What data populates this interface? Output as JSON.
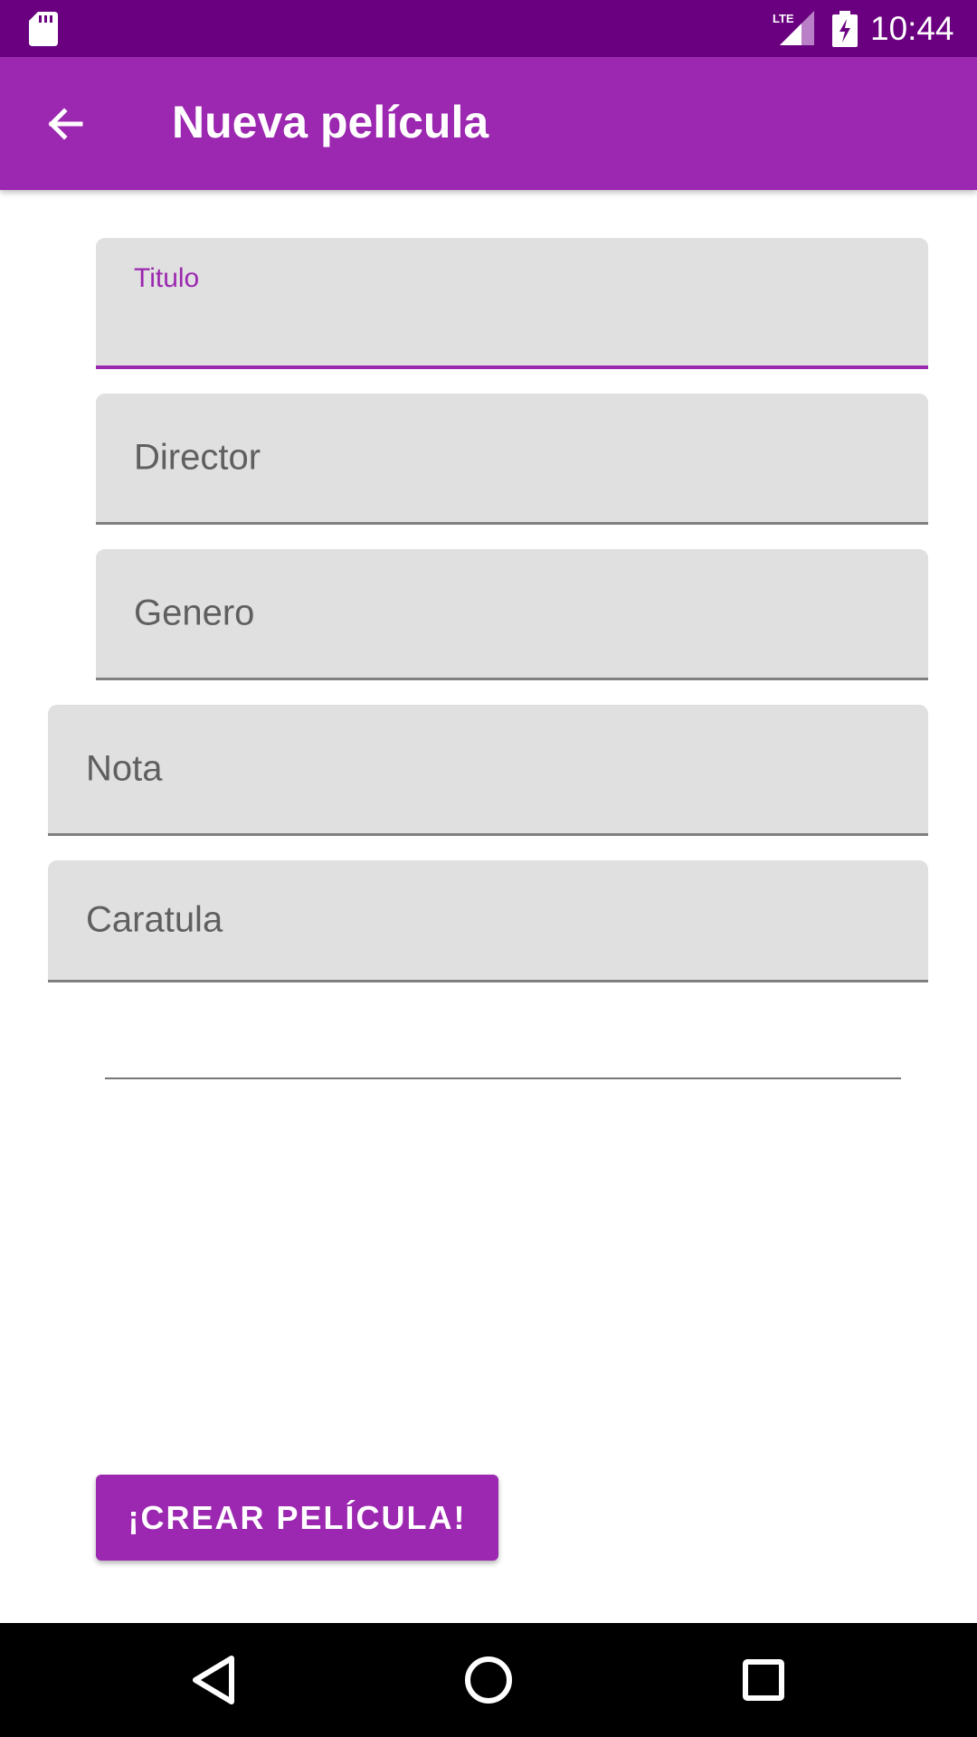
{
  "status_bar": {
    "time": "10:44",
    "network_label": "LTE",
    "background": "#6a0080",
    "icons": [
      "sd-card-icon",
      "lte-signal-icon",
      "battery-charging-icon"
    ]
  },
  "app_bar": {
    "title": "Nueva película",
    "background": "#9c27b0",
    "back_icon": "arrow-back-icon"
  },
  "form": {
    "titulo": {
      "label": "Titulo",
      "value": ""
    },
    "director": {
      "placeholder": "Director",
      "value": ""
    },
    "genero": {
      "placeholder": "Genero",
      "value": ""
    },
    "nota": {
      "placeholder": "Nota",
      "value": ""
    },
    "caratula": {
      "placeholder": "Caratula",
      "value": ""
    }
  },
  "actions": {
    "create_label": "¡CREAR PELÍCULA!"
  },
  "nav_bar": {
    "icons": [
      "nav-back-icon",
      "nav-home-icon",
      "nav-recents-icon"
    ]
  },
  "colors": {
    "accent": "#9c27b0",
    "status_bar": "#6a0080",
    "field_background": "#e0e0e0"
  }
}
